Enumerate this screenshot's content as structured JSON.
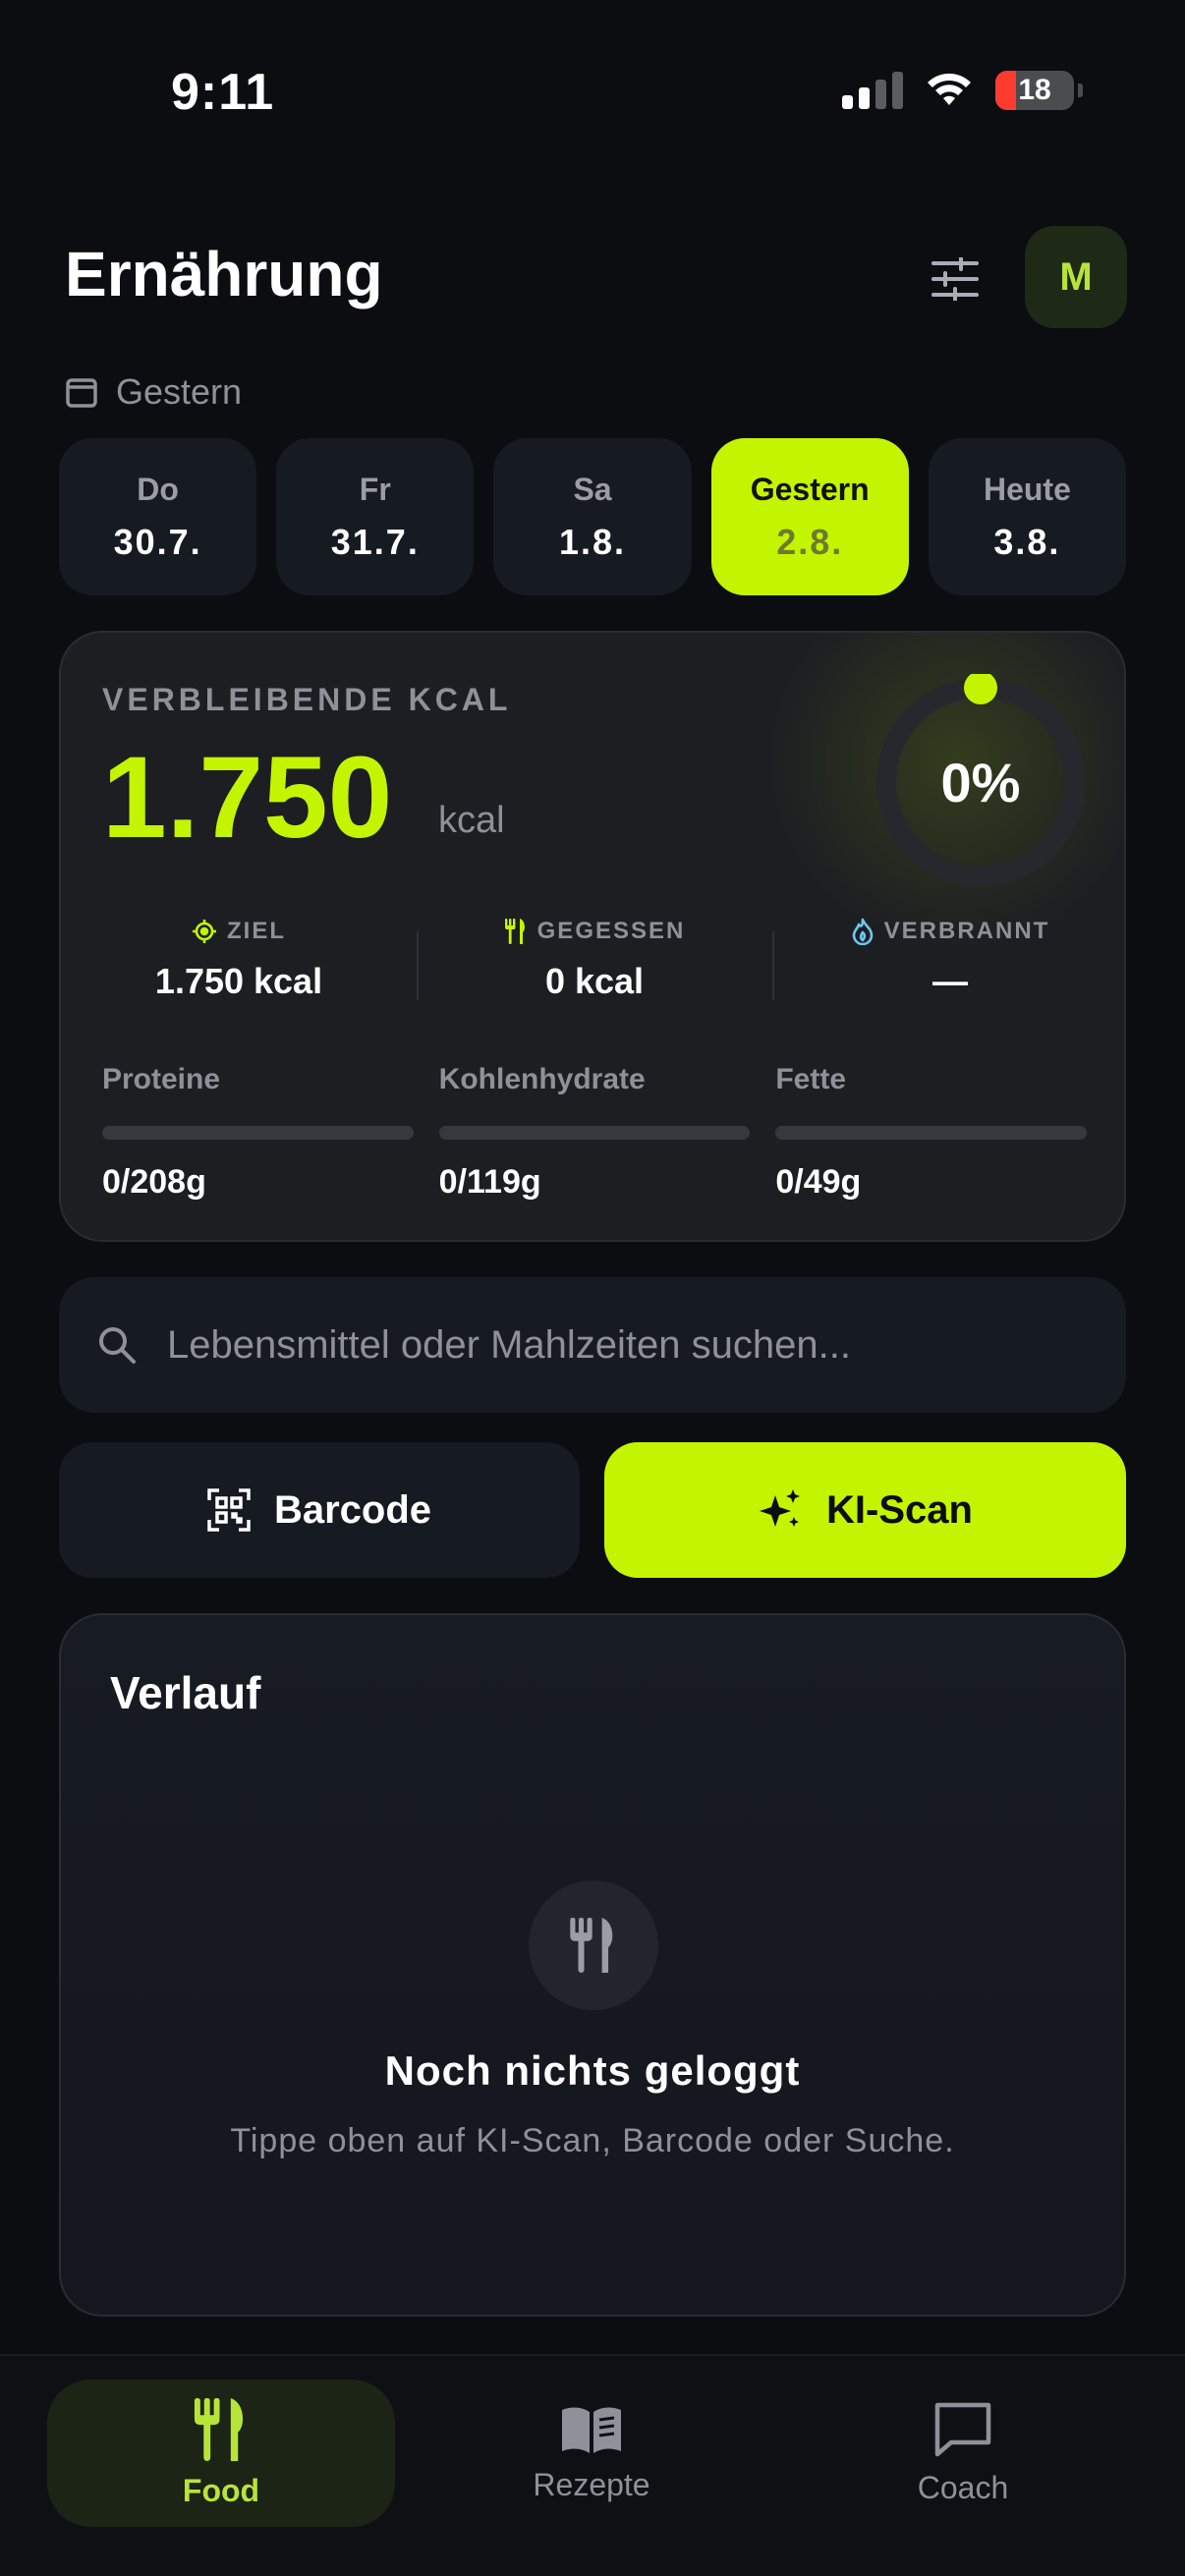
{
  "status_bar": {
    "time": "9:11",
    "battery_level": "18",
    "icons": [
      "signal-icon",
      "wifi-icon",
      "battery-icon"
    ]
  },
  "header": {
    "title": "Ernährung",
    "avatar_initial": "M",
    "filter_icon": "sliders-icon"
  },
  "date_selector": {
    "current_label": "Gestern",
    "days": [
      {
        "name": "Do",
        "date": "30.7."
      },
      {
        "name": "Fr",
        "date": "31.7."
      },
      {
        "name": "Sa",
        "date": "1.8."
      },
      {
        "name": "Gestern",
        "date": "2.8.",
        "active": true
      },
      {
        "name": "Heute",
        "date": "3.8."
      }
    ]
  },
  "summary": {
    "remaining_label": "VERBLEIBENDE KCAL",
    "remaining_value": "1.750",
    "remaining_unit": "kcal",
    "progress_percent": "0%",
    "progress_fraction": 0,
    "stats": [
      {
        "label": "ZIEL",
        "value": "1.750 kcal",
        "icon": "target-icon"
      },
      {
        "label": "GEGESSEN",
        "value": "0 kcal",
        "icon": "utensils-icon"
      },
      {
        "label": "VERBRANNT",
        "value": "—",
        "icon": "flame-icon"
      }
    ],
    "macros": [
      {
        "name": "Proteine",
        "value": "0/208g",
        "fraction": 0
      },
      {
        "name": "Kohlenhydrate",
        "value": "0/119g",
        "fraction": 0
      },
      {
        "name": "Fette",
        "value": "0/49g",
        "fraction": 0
      }
    ]
  },
  "search": {
    "placeholder": "Lebensmittel oder Mahlzeiten suchen...",
    "value": ""
  },
  "actions": {
    "barcode_label": "Barcode",
    "scan_label": "KI-Scan"
  },
  "history": {
    "title": "Verlauf",
    "empty_title": "Noch nichts geloggt",
    "empty_subtitle": "Tippe oben auf KI-Scan, Barcode oder Suche."
  },
  "nav": {
    "items": [
      {
        "label": "Food",
        "icon": "utensils-icon",
        "active": true
      },
      {
        "label": "Rezepte",
        "icon": "book-icon"
      },
      {
        "label": "Coach",
        "icon": "chat-icon"
      }
    ]
  },
  "colors": {
    "accent": "#c4f500",
    "background": "#0b0d11",
    "card": "#161a21"
  }
}
